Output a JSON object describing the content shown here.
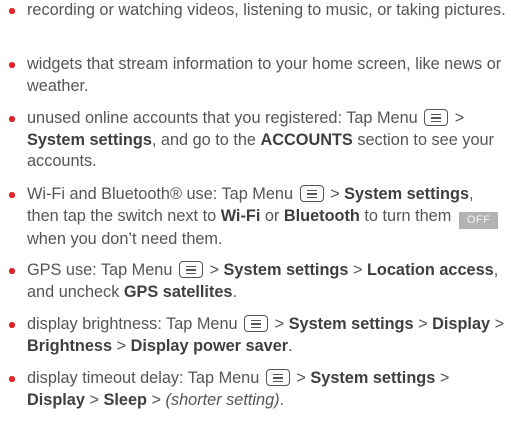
{
  "separator": ">",
  "menu_icon_name": "menu-icon",
  "bullet_color": "#e32127",
  "items": [
    {
      "text": "recording or watching videos, listening to music, or taking pictures."
    },
    {
      "text": "widgets that stream information to your home screen, like news or weather."
    },
    {
      "prefix": "unused online accounts that you registered: Tap Menu",
      "system_settings": "System settings",
      "mid": ", and go to the",
      "accounts": "ACCOUNTS",
      "suffix": "section to see your accounts."
    },
    {
      "prefix": "Wi-Fi and Bluetooth® use: Tap Menu",
      "system_settings": "System settings",
      "mid": ", then tap the switch next to",
      "wifi": "Wi-Fi",
      "or": "or",
      "bluetooth": "Bluetooth",
      "to_turn_them": "to turn them",
      "off_label": "OFF",
      "suffix": "when you don’t need them."
    },
    {
      "prefix": "GPS use: Tap Menu",
      "system_settings": "System settings",
      "location_access": "Location access",
      "mid": ", and uncheck",
      "gps_satellites": "GPS satellites",
      "end": "."
    },
    {
      "prefix": "display brightness: Tap Menu",
      "system_settings": "System settings",
      "display": "Display",
      "brightness": "Brightness",
      "display_power_saver": "Display power saver",
      "end": "."
    },
    {
      "prefix": "display timeout delay: Tap Menu",
      "system_settings": "System settings",
      "display": "Display",
      "sleep": "Sleep",
      "shorter_setting": "(shorter setting)",
      "end": "."
    }
  ]
}
